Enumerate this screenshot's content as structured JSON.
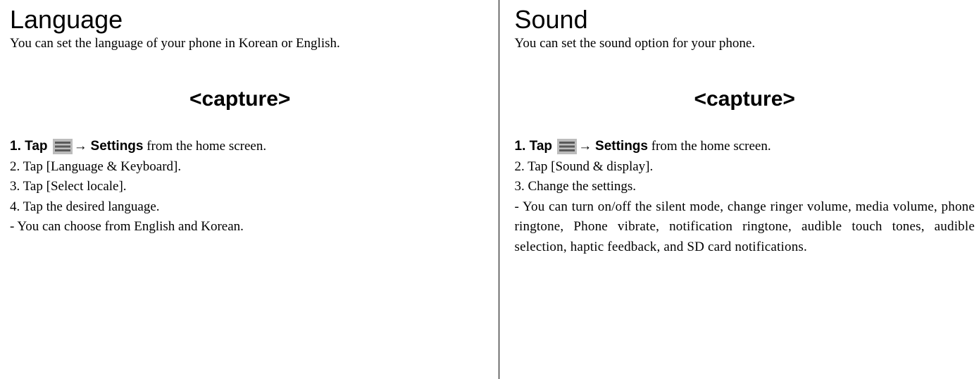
{
  "left": {
    "heading": "Language",
    "subheading": "You can set the language of your phone in Korean or English.",
    "capture": "<capture>",
    "step1_lead": "1. Tap ",
    "step1_arrow": "→ ",
    "step1_settings": "Settings",
    "step1_rest": " from the home screen.",
    "step2": "2. Tap [Language & Keyboard].",
    "step3": "3. Tap [Select locale].",
    "step4": "4. Tap the desired language.",
    "note": "- You can choose from English and Korean."
  },
  "right": {
    "heading": "Sound",
    "subheading": "You can set the sound option for your phone.",
    "capture": "<capture>",
    "step1_lead": "1. Tap ",
    "step1_arrow": "→ ",
    "step1_settings": "Settings",
    "step1_rest": " from the home screen.",
    "step2": "2. Tap [Sound & display].",
    "step3": "3. Change the settings.",
    "note": "- You can turn on/off the silent mode, change ringer volume, media volume, phone ringtone, Phone vibrate, notification ringtone, audible touch tones, audible selection, haptic feedback, and SD card notifications."
  }
}
